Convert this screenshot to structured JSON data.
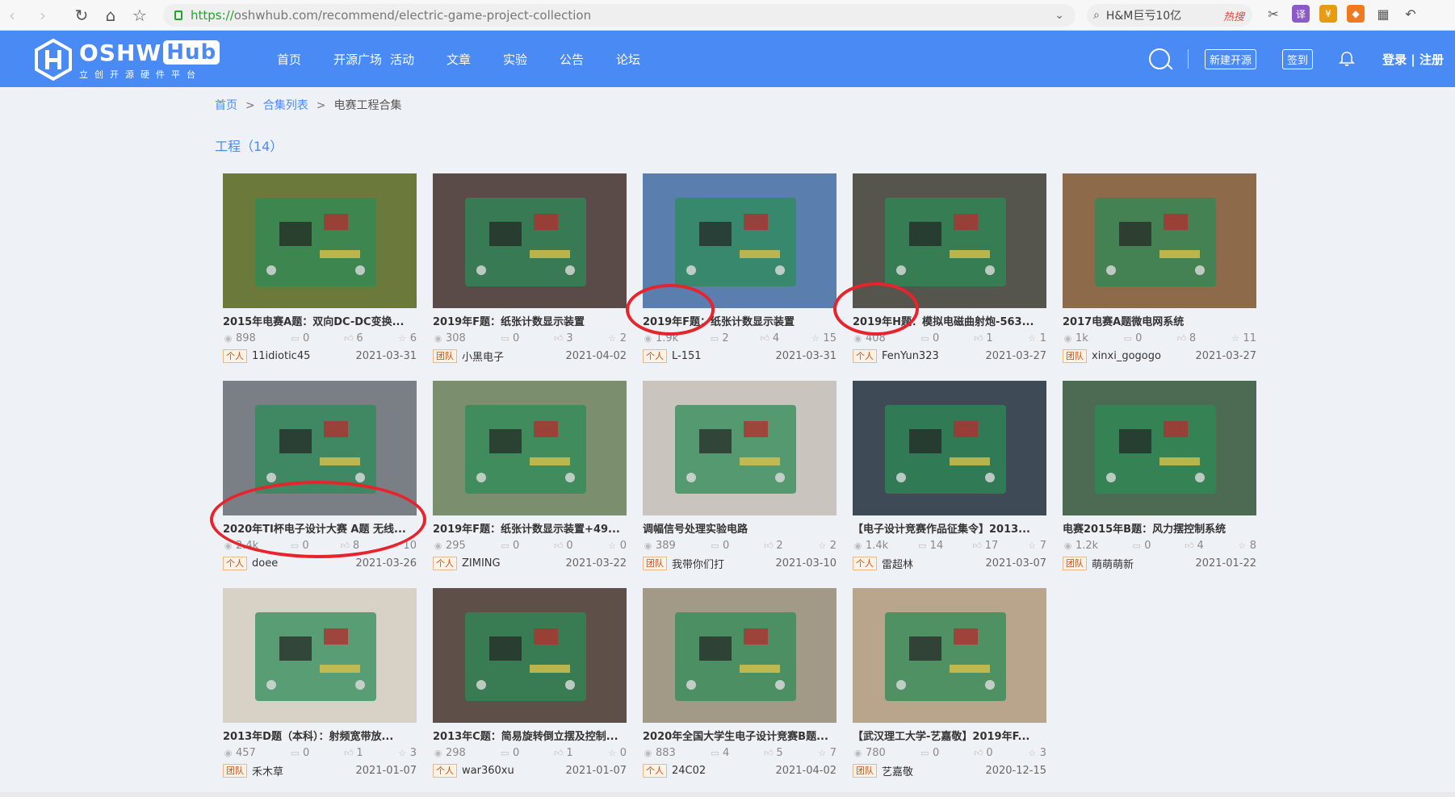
{
  "browser": {
    "url_https": "https://",
    "url_rest": "oshwhub.com/recommend/electric-game-project-collection",
    "search_text": "H&M巨亏10亿",
    "search_hot": "热搜"
  },
  "site": {
    "logo_main": "OSHW",
    "logo_hub": "Hub",
    "logo_sub": "立创开源硬件平台",
    "nav": [
      "首页",
      "开源广场",
      "活动",
      "文章",
      "实验",
      "公告",
      "论坛"
    ],
    "new_project": "新建开源",
    "checkin": "签到",
    "login": "登录 | 注册"
  },
  "breadcrumb": {
    "home": "首页",
    "sep": ">",
    "list": "合集列表",
    "current": "电赛工程合集"
  },
  "section_title": "工程（14）",
  "projects": [
    {
      "title": "2015年电赛A题：双向DC-DC变换...",
      "views": "898",
      "comments": "0",
      "likes": "6",
      "stars": "6",
      "type": "个人",
      "author": "11idiotic45",
      "date": "2021-03-31",
      "thumb": "#6b7a3a"
    },
    {
      "title": "2019年F题：纸张计数显示装置",
      "views": "308",
      "comments": "0",
      "likes": "3",
      "stars": "2",
      "type": "团队",
      "author": "小黑电子",
      "date": "2021-04-02",
      "thumb": "#5a4a48"
    },
    {
      "title": "2019年F题：纸张计数显示装置",
      "views": "1.9k",
      "comments": "2",
      "likes": "4",
      "stars": "15",
      "type": "个人",
      "author": "L-151",
      "date": "2021-03-31",
      "thumb": "#5a7fae"
    },
    {
      "title": "2019年H题：模拟电磁曲射炮-563...",
      "views": "408",
      "comments": "0",
      "likes": "1",
      "stars": "1",
      "type": "个人",
      "author": "FenYun323",
      "date": "2021-03-27",
      "thumb": "#55554e"
    },
    {
      "title": "2017电赛A题微电网系统",
      "views": "1k",
      "comments": "0",
      "likes": "8",
      "stars": "11",
      "type": "团队",
      "author": "xinxi_gogogo",
      "date": "2021-03-27",
      "thumb": "#8c6a4a"
    },
    {
      "title": "2020年TI杯电子设计大赛 A题 无线...",
      "views": "2.4k",
      "comments": "0",
      "likes": "8",
      "stars": "10",
      "type": "个人",
      "author": "doee",
      "date": "2021-03-26",
      "thumb": "#7a7f86"
    },
    {
      "title": "2019年F题：纸张计数显示装置+49...",
      "views": "295",
      "comments": "0",
      "likes": "0",
      "stars": "0",
      "type": "个人",
      "author": "ZIMING",
      "date": "2021-03-22",
      "thumb": "#7b8f6e"
    },
    {
      "title": "调幅信号处理实验电路",
      "views": "389",
      "comments": "0",
      "likes": "2",
      "stars": "2",
      "type": "团队",
      "author": "我带你们打",
      "date": "2021-03-10",
      "thumb": "#c9c4bd"
    },
    {
      "title": "【电子设计竞赛作品征集令】2013...",
      "views": "1.4k",
      "comments": "14",
      "likes": "17",
      "stars": "7",
      "type": "个人",
      "author": "雷超林",
      "date": "2021-03-07",
      "thumb": "#3e4a55"
    },
    {
      "title": "电赛2015年B题：风力摆控制系统",
      "views": "1.2k",
      "comments": "0",
      "likes": "4",
      "stars": "8",
      "type": "团队",
      "author": "萌萌萌新",
      "date": "2021-01-22",
      "thumb": "#4d6a52"
    },
    {
      "title": "2013年D题（本科）：射频宽带放...",
      "views": "457",
      "comments": "0",
      "likes": "1",
      "stars": "3",
      "type": "团队",
      "author": "禾木草",
      "date": "2021-01-07",
      "thumb": "#d8d2c6"
    },
    {
      "title": "2013年C题：简易旋转倒立摆及控制...",
      "views": "298",
      "comments": "0",
      "likes": "1",
      "stars": "0",
      "type": "个人",
      "author": "war360xu",
      "date": "2021-01-07",
      "thumb": "#5e5048"
    },
    {
      "title": "2020年全国大学生电子设计竞赛B题...",
      "views": "883",
      "comments": "4",
      "likes": "5",
      "stars": "7",
      "type": "个人",
      "author": "24C02",
      "date": "2021-04-02",
      "thumb": "#a29a86"
    },
    {
      "title": "【武汉理工大学-艺嘉敬】2019年F...",
      "views": "780",
      "comments": "0",
      "likes": "0",
      "stars": "3",
      "type": "团队",
      "author": "艺嘉敬",
      "date": "2020-12-15",
      "thumb": "#b8a58c"
    }
  ]
}
